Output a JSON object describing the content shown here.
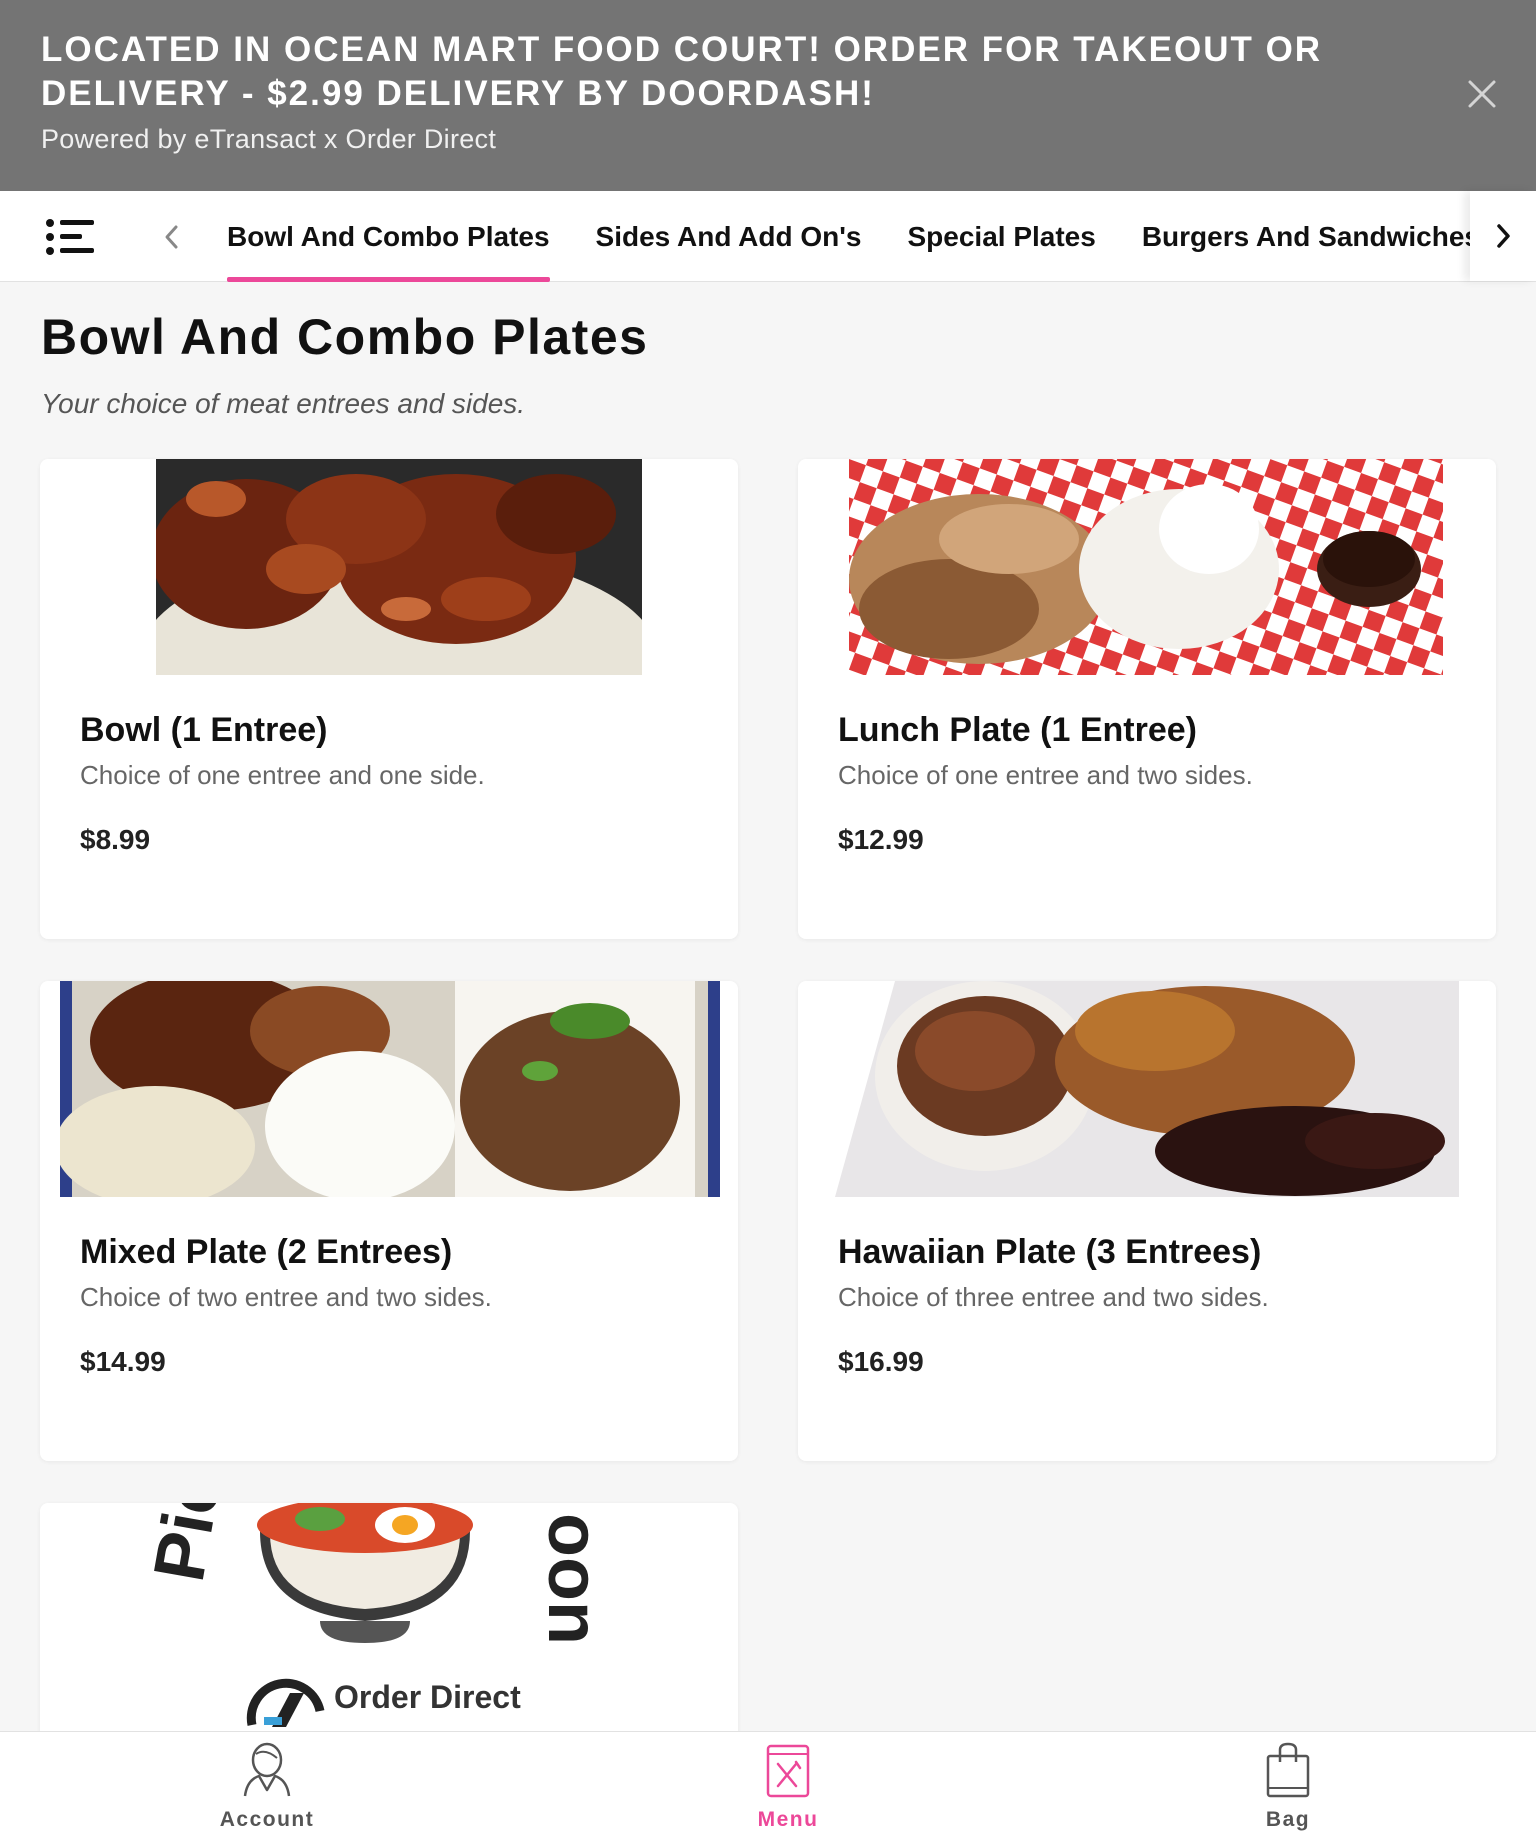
{
  "banner": {
    "title": "LOCATED IN OCEAN MART FOOD COURT! ORDER FOR TAKEOUT OR DELIVERY - $2.99 DELIVERY BY DOORDASH!",
    "subtitle": "Powered by eTransact x Order Direct",
    "close_icon": "close-icon"
  },
  "categories": [
    {
      "label": "Bowl And Combo Plates",
      "active": true
    },
    {
      "label": "Sides And Add On's",
      "active": false
    },
    {
      "label": "Special Plates",
      "active": false
    },
    {
      "label": "Burgers And Sandwiches",
      "active": false
    }
  ],
  "section": {
    "title": "Bowl And Combo Plates",
    "description": "Your choice of meat entrees and sides."
  },
  "items": [
    {
      "name": "Bowl (1 Entree)",
      "description": "Choice of one entree and one side.",
      "price": "$8.99"
    },
    {
      "name": "Lunch Plate (1 Entree)",
      "description": "Choice of one entree and two sides.",
      "price": "$12.99"
    },
    {
      "name": "Mixed Plate (2 Entrees)",
      "description": "Choice of two entree and two sides.",
      "price": "$14.99"
    },
    {
      "name": "Hawaiian Plate (3 Entrees)",
      "description": "Choice of three entree and two sides.",
      "price": "$16.99"
    }
  ],
  "placeholder_card": {
    "logo_text": "Order Direct",
    "arc_text_left": "Pict",
    "arc_text_right": "oon"
  },
  "bottom_nav": {
    "account": "Account",
    "menu": "Menu",
    "bag": "Bag"
  },
  "colors": {
    "accent": "#ec4899",
    "banner_bg": "#747474"
  }
}
